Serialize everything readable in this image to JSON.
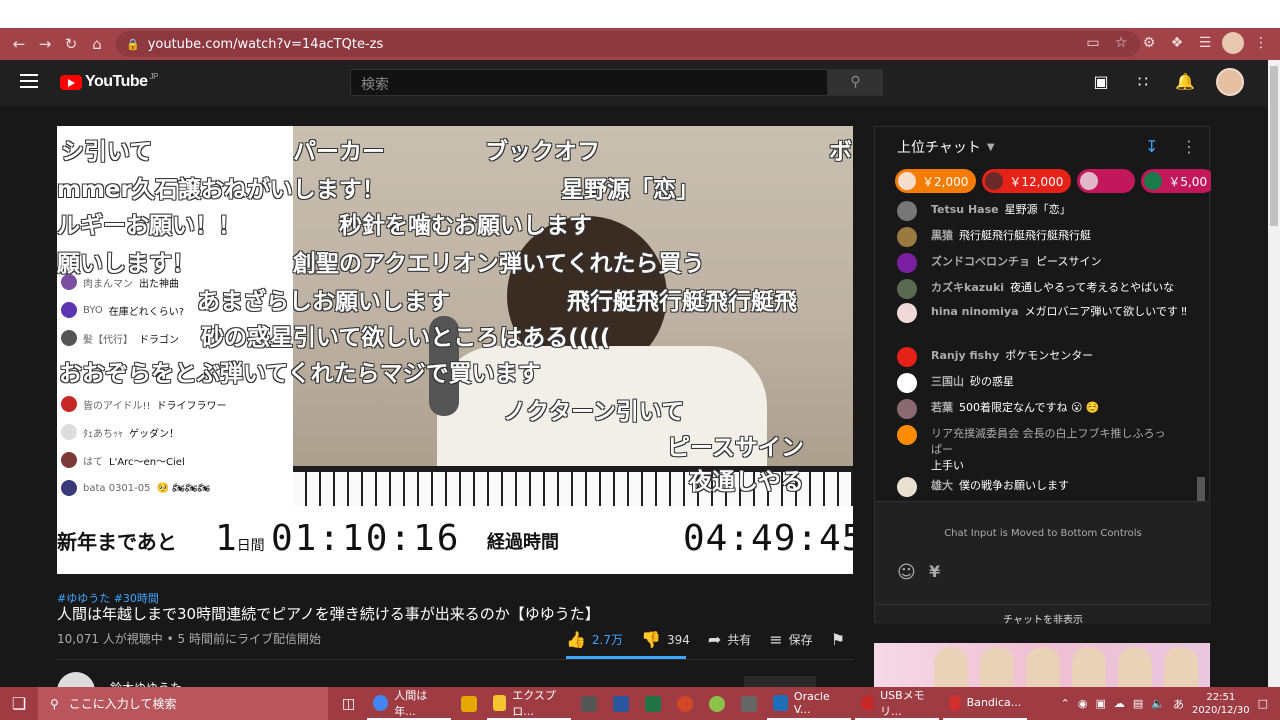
{
  "browser": {
    "url": "youtube.com/watch?v=14acTQte-zs",
    "nav_icons": [
      "back-icon",
      "forward-icon",
      "reload-icon",
      "home-icon"
    ]
  },
  "header": {
    "logo": "YouTube",
    "logo_region": "JP",
    "search_placeholder": "検索"
  },
  "player": {
    "danmaku": [
      "シ引いて",
      "パーカー",
      "ブックオフ",
      "ボ",
      "mmer久石譲おねがいします！",
      "星野源「恋」",
      "ルギーお願い！！",
      "秒針を噛むお願いします",
      "願いします！",
      "創聖のアクエリオン弾いてくれたら買う",
      "あまざらしお願いします",
      "飛行艇飛行艇飛行艇飛",
      "砂の惑星引いて欲しいところはある((((",
      "おおぞらをとぶ弾いてくれたらマジで買います",
      "ノクターン引いて",
      "ピースサイン",
      "夜通しやる"
    ],
    "inset_chat": [
      {
        "author": "肉まんマン",
        "text": "出た神曲"
      },
      {
        "author": "BYO",
        "text": "在庫どれくらい?"
      },
      {
        "author": "髪【代行】",
        "text": "ドラゴン"
      },
      {
        "author": "皆のアイドル!!",
        "text": "ドライフラワー"
      },
      {
        "author": "ﾀｪあちｯｬ",
        "text": "ゲッダン！"
      },
      {
        "author": "はて",
        "text": "L'Arc〜en〜Ciel"
      },
      {
        "author": "bata 0301-05",
        "text": "🥺 🏍🏍🏍"
      }
    ],
    "timer": {
      "label": "新年まであと",
      "days": "1",
      "days_unit": "日間",
      "clock": "01:10:16",
      "elapsed_label": "経過時間",
      "elapsed": "04:49:45"
    }
  },
  "video": {
    "hashtags": "#ゆゆうた #30時間",
    "title": "人間は年越しまで30時間連続でピアノを弾き続ける事が出来るのか【ゆゆうた】",
    "stats": "10,071 人が視聴中 • 5 時間前にライブ配信開始",
    "likes": "2.7万",
    "dislikes": "394",
    "share": "共有",
    "save": "保存",
    "channel": "鈴木ゆゆうた"
  },
  "chat": {
    "mode": "上位チャット",
    "tickers": [
      {
        "amount": "￥2,000",
        "color": "#f57c00"
      },
      {
        "amount": "￥12,000",
        "color": "#e62117"
      },
      {
        "amount": "",
        "color": "#c2185b"
      },
      {
        "amount": "￥5,00",
        "color": "#c2185b"
      }
    ],
    "messages": [
      {
        "author": "Tetsu Hase",
        "text": "星野源「恋」",
        "color": "#777777"
      },
      {
        "author": "黒猿",
        "text": "飛行艇飛行艇飛行艇飛行艇",
        "color": "#9a7a40"
      },
      {
        "author": "ズンドコベロンチョ",
        "text": "ピースサイン",
        "color": "#7b1fa2"
      },
      {
        "author": "カズキkazuki",
        "text": "夜通しやるって考えるとやばいな",
        "color": "#5a6a50"
      },
      {
        "author": "hina ninomiya",
        "text": "メガロバニア弾いて欲しいです ‼",
        "color": "#f0d8d8"
      },
      {
        "author": "Ranjy fishy",
        "text": "ポケモンセンター",
        "color": "#e62117"
      },
      {
        "author": "三国山",
        "text": "砂の惑星",
        "color": "#ffffff"
      },
      {
        "author": "若葉",
        "text": "500着限定なんですね 😮 ☺️",
        "color": "#8a6a70"
      },
      {
        "author": "リア充撲滅委員会 会長の白上フブキ推しふろっぱー",
        "text": "上手い",
        "color": "#ff8c00"
      },
      {
        "author": "雄大",
        "text": "僕の戦争お願いします",
        "color": "#e8e0d0"
      }
    ],
    "input_info": "Chat Input is Moved to Bottom Controls",
    "hide_label": "チャットを非表示"
  },
  "taskbar": {
    "search_placeholder": "ここに入力して検索",
    "apps": [
      {
        "label": "人間は年...",
        "color": "#4285f4"
      },
      {
        "label": "",
        "color": "#e6a800"
      },
      {
        "label": "エクスプロ...",
        "color": "#f4c430"
      },
      {
        "label": "",
        "color": "#555555"
      },
      {
        "label": "",
        "color": "#2b579a"
      },
      {
        "label": "",
        "color": "#217346"
      },
      {
        "label": "",
        "color": "#d24726"
      },
      {
        "label": "",
        "color": "#8bc34a"
      },
      {
        "label": "",
        "color": "#666666"
      },
      {
        "label": "Oracle V...",
        "color": "#1e6fb6"
      },
      {
        "label": "USBメモリ...",
        "color": "#c62828"
      },
      {
        "label": "Bandica...",
        "color": "#d32f2f"
      }
    ],
    "ime": "あ",
    "time": "22:51",
    "date": "2020/12/30"
  }
}
